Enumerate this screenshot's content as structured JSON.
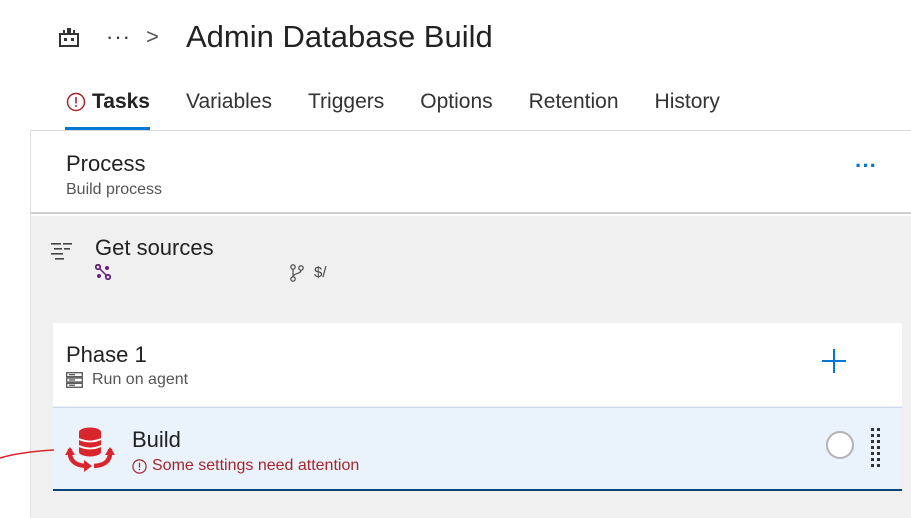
{
  "header": {
    "breadcrumb_more": "···",
    "breadcrumb_separator": ">",
    "title": "Admin Database Build",
    "pipeline_icon": "build-pipeline-icon"
  },
  "tabs": [
    {
      "label": "Tasks",
      "active": true,
      "has_error": true
    },
    {
      "label": "Variables",
      "active": false
    },
    {
      "label": "Triggers",
      "active": false
    },
    {
      "label": "Options",
      "active": false
    },
    {
      "label": "Retention",
      "active": false
    },
    {
      "label": "History",
      "active": false
    }
  ],
  "process": {
    "title": "Process",
    "subtitle": "Build process",
    "more_label": "···"
  },
  "get_sources": {
    "title": "Get sources",
    "repository": "",
    "branch": "$/"
  },
  "phase": {
    "title": "Phase 1",
    "subtitle": "Run on agent",
    "add_icon": "plus-icon"
  },
  "task": {
    "title": "Build",
    "warning": "Some settings need attention",
    "icon": "database-build-icon"
  },
  "colors": {
    "accent": "#0078d4",
    "error": "#a4262c",
    "task_icon_red": "#d9262c",
    "selected_row_bg": "#eaf2fb",
    "section_bg": "#f0f0f0"
  }
}
